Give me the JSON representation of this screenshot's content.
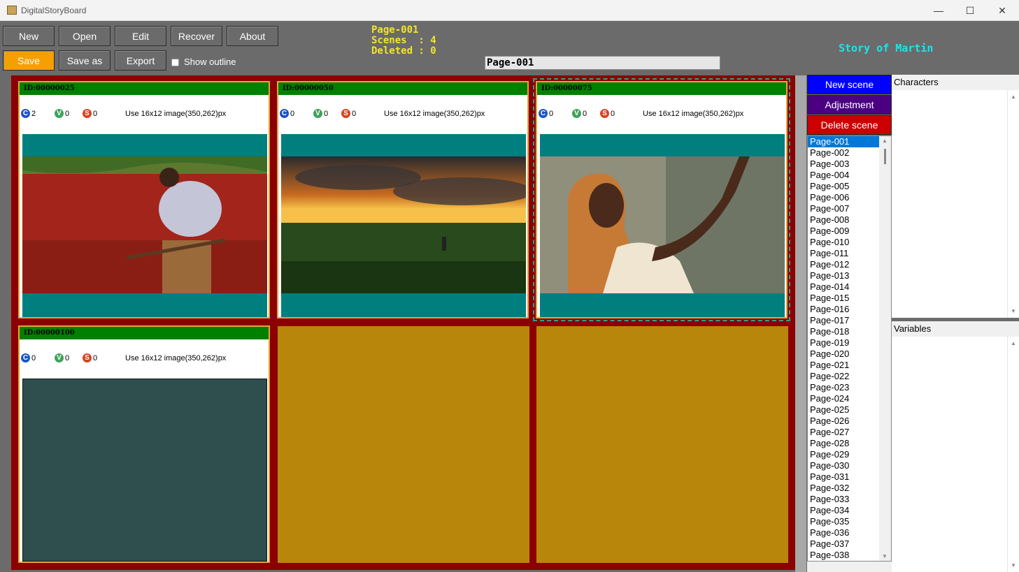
{
  "window": {
    "title": "DigitalStoryBoard",
    "minimize": "—",
    "maximize": "☐",
    "close": "✕"
  },
  "toolbar": {
    "new": "New",
    "open": "Open",
    "edit": "Edit",
    "recover": "Recover",
    "about": "About",
    "save": "Save",
    "save_as": "Save as",
    "export": "Export",
    "show_outline": "Show outline"
  },
  "info": {
    "text": "Page-001\nScenes  : 4\nDeleted : 0"
  },
  "page_field": "Page-001",
  "story_title": "Story of Martin",
  "colors": {
    "save": "#f5a000",
    "new_scene": "#0000ff",
    "adjustment": "#4b0082",
    "delete_scene": "#cc0000",
    "board": "#8b0000",
    "empty_slot": "#b8860b"
  },
  "cards": [
    {
      "id": "ID:00000025",
      "c": "2",
      "v": "0",
      "s": "0",
      "use": "Use 16x12 image(350,262)px"
    },
    {
      "id": "ID:00000050",
      "c": "0",
      "v": "0",
      "s": "0",
      "use": "Use 16x12 image(350,262)px"
    },
    {
      "id": "ID:00000075",
      "c": "0",
      "v": "0",
      "s": "0",
      "use": "Use 16x12 image(350,262)px"
    },
    {
      "id": "ID:00000100",
      "c": "0",
      "v": "0",
      "s": "0",
      "use": "Use 16x12 image(350,262)px"
    }
  ],
  "badges": {
    "c": "C",
    "v": "V",
    "s": "S"
  },
  "side": {
    "new_scene": "New scene",
    "adjustment": "Adjustment",
    "delete_scene": "Delete scene"
  },
  "scenes": [
    "Page-001",
    "Page-002",
    "Page-003",
    "Page-004",
    "Page-005",
    "Page-006",
    "Page-007",
    "Page-008",
    "Page-009",
    "Page-010",
    "Page-011",
    "Page-012",
    "Page-013",
    "Page-014",
    "Page-015",
    "Page-016",
    "Page-017",
    "Page-018",
    "Page-019",
    "Page-020",
    "Page-021",
    "Page-022",
    "Page-023",
    "Page-024",
    "Page-025",
    "Page-026",
    "Page-027",
    "Page-028",
    "Page-029",
    "Page-030",
    "Page-031",
    "Page-032",
    "Page-033",
    "Page-034",
    "Page-035",
    "Page-036",
    "Page-037",
    "Page-038"
  ],
  "panels": {
    "characters": "Characters",
    "variables": "Variables"
  }
}
